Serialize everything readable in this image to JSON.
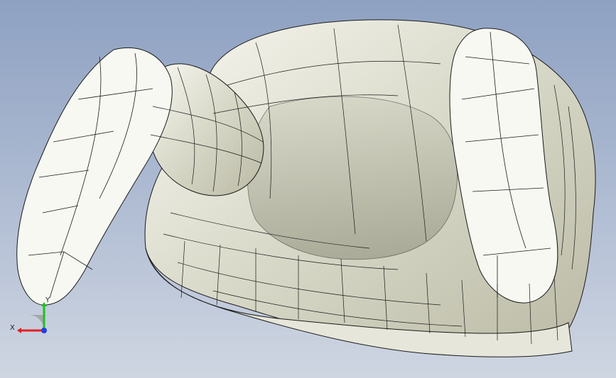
{
  "viewport": {
    "background_top": "#8ea1c2",
    "background_bottom": "#cfd6e2",
    "model_color": "#ecece2",
    "edge_color": "#1a1a1a"
  },
  "triad": {
    "x_label": "X",
    "y_label": "Y",
    "x_color": "#e02020",
    "y_color": "#20c020",
    "z_color": "#2040e0"
  }
}
